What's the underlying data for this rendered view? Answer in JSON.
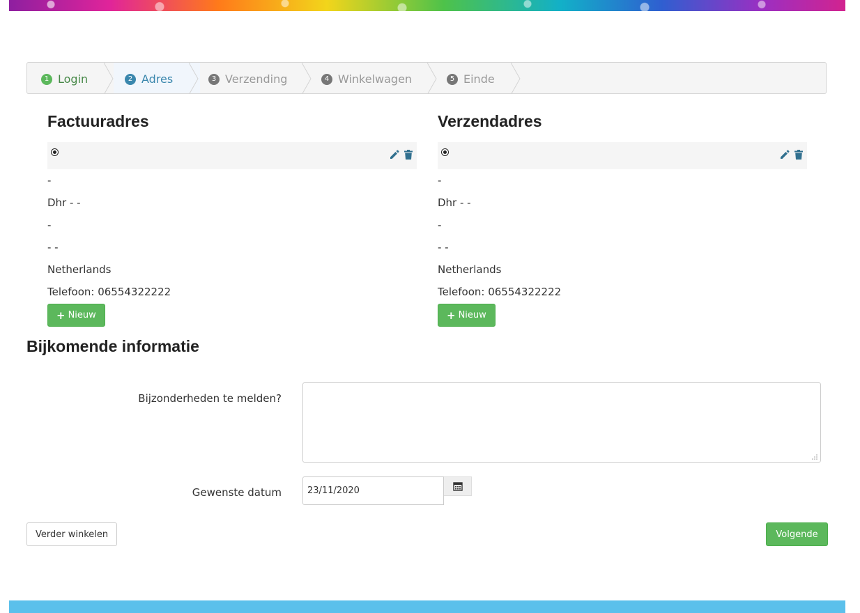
{
  "wizard": {
    "steps": [
      {
        "num": "1",
        "label": "Login",
        "state": "done"
      },
      {
        "num": "2",
        "label": "Adres",
        "state": "active"
      },
      {
        "num": "3",
        "label": "Verzending",
        "state": "todo"
      },
      {
        "num": "4",
        "label": "Winkelwagen",
        "state": "todo"
      },
      {
        "num": "5",
        "label": "Einde",
        "state": "todo"
      }
    ]
  },
  "billing": {
    "title": "Factuuradres",
    "lines": [
      "-",
      "Dhr - -",
      "-",
      "- -",
      "Netherlands",
      "Telefoon: 06554322222"
    ],
    "new_label": "Nieuw",
    "edit_icon": "pencil-icon",
    "delete_icon": "trash-icon"
  },
  "shipping": {
    "title": "Verzendadres",
    "lines": [
      "-",
      "Dhr - -",
      "-",
      "- -",
      "Netherlands",
      "Telefoon: 06554322222"
    ],
    "new_label": "Nieuw",
    "edit_icon": "pencil-icon",
    "delete_icon": "trash-icon"
  },
  "extra": {
    "title": "Bijkomende informatie",
    "remarks_label": "Bijzonderheden te melden?",
    "remarks_value": "",
    "date_label": "Gewenste datum",
    "date_value": "23/11/2020",
    "calendar_icon": "calendar-icon"
  },
  "actions": {
    "continue_shopping": "Verder winkelen",
    "next": "Volgende"
  },
  "colors": {
    "success": "#5cb85c",
    "active_step": "#3a87ad",
    "icon_blue": "#31708f",
    "footer": "#5bc0eb"
  }
}
